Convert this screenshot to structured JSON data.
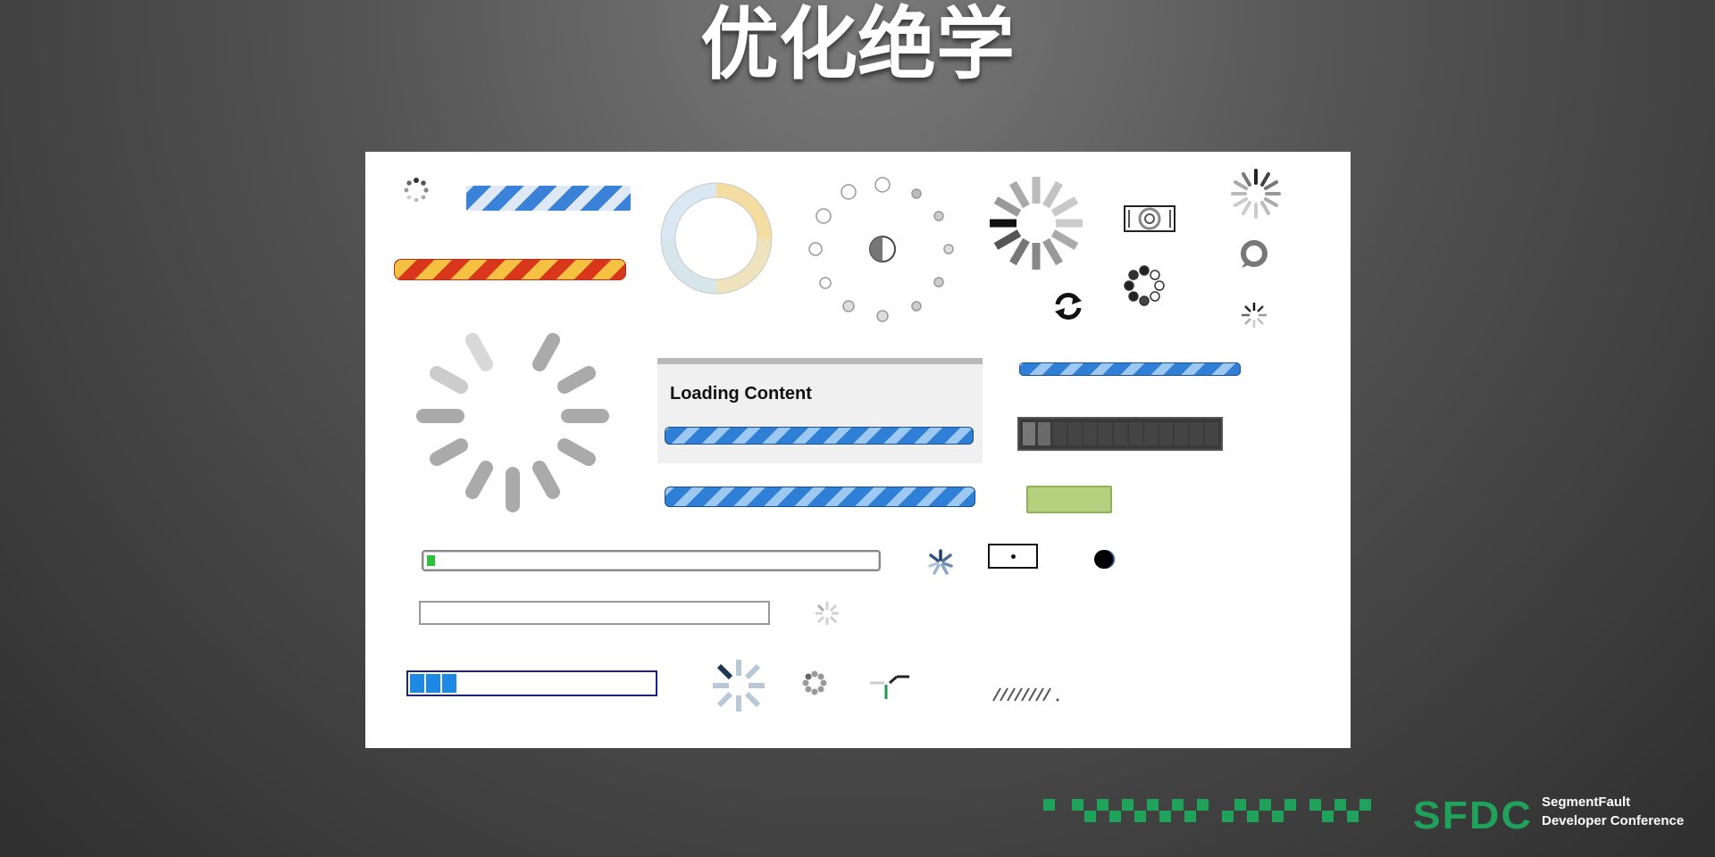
{
  "slide": {
    "title": "优化绝学"
  },
  "panel": {
    "loading_label": "Loading Content"
  },
  "footer": {
    "logo": "SFDC",
    "org_line1": "SegmentFault",
    "org_line2": "Developer Conference"
  },
  "colors": {
    "logo_green": "#1fa35a",
    "bar_blue": "#2f7fd6",
    "bar_orange": "#d8371b",
    "bar_yellow": "#f6c040",
    "green_block": "#b5d17f"
  },
  "icons": [
    "dots-spinner-icon",
    "ring-loader-icon",
    "circle-dots-loader-icon",
    "gray-bars-spinner-icon",
    "refresh-arrows-icon",
    "large-bars-spinner-icon",
    "asterisk-spinner-icon",
    "hatched-loader-icon"
  ]
}
